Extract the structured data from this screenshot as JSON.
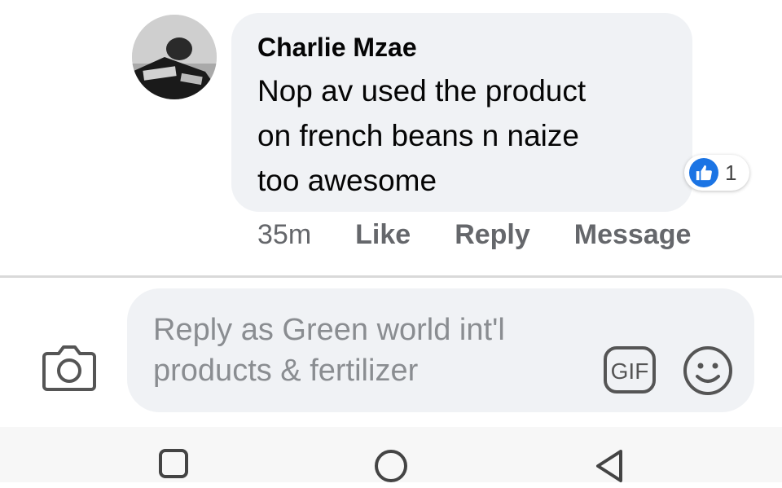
{
  "comment": {
    "author": "Charlie Mzae",
    "text_lines": [
      "Nop av used the product",
      "on french beans n naize",
      "too awesome"
    ],
    "reaction_count": "1",
    "reaction_icon": "thumbs-up-icon",
    "time": "35m",
    "actions": [
      "Like",
      "Reply",
      "Message"
    ]
  },
  "composer": {
    "placeholder_lines": [
      "Reply as Green world int'l",
      "products & fertilizer"
    ],
    "left_icon": "camera-icon",
    "right_icons": [
      "gif-icon",
      "smiley-icon"
    ]
  },
  "colors": {
    "bubble": "#f0f2f5",
    "like_blue": "#1b74e4",
    "meta_gray": "#65676b",
    "placeholder_gray": "#8a8d91"
  },
  "navbar": {
    "icons": [
      "recent-apps-icon",
      "home-icon",
      "back-icon"
    ]
  }
}
